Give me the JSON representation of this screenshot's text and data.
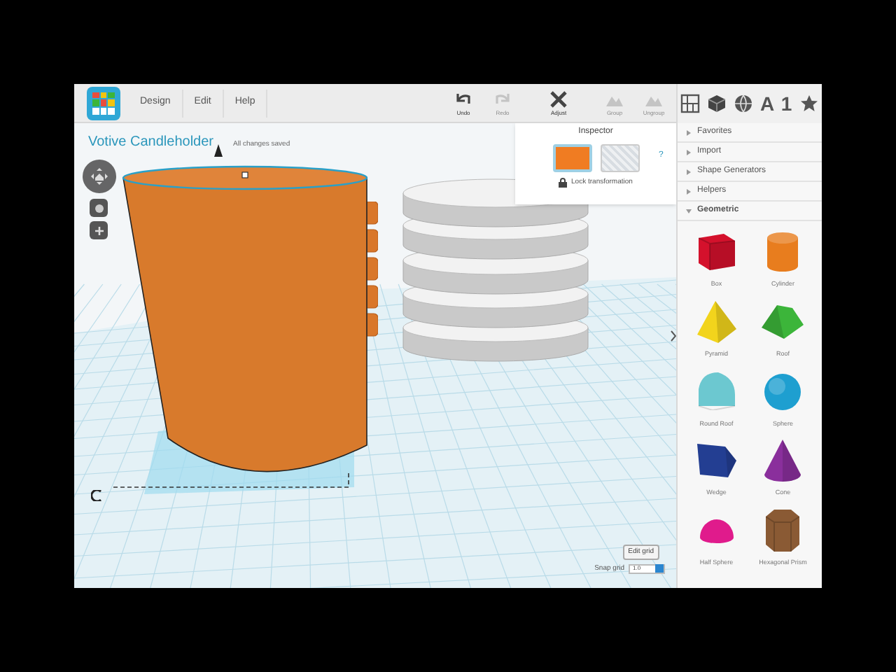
{
  "menu": [
    {
      "label": "Design"
    },
    {
      "label": "Edit"
    },
    {
      "label": "Help"
    }
  ],
  "tools": [
    {
      "kind": "undo",
      "label": "Undo",
      "disabled": false
    },
    {
      "kind": "redo",
      "label": "Redo",
      "disabled": true
    },
    {
      "kind": "adjust",
      "label": "Adjust",
      "disabled": false
    },
    {
      "kind": "group",
      "label": "Group",
      "disabled": true
    },
    {
      "kind": "ungroup",
      "label": "Ungroup",
      "disabled": true
    }
  ],
  "panel_tabs": [
    {
      "kind": "workplane"
    },
    {
      "kind": "cube"
    },
    {
      "kind": "globe"
    },
    {
      "kind": "text",
      "label": "A"
    },
    {
      "kind": "text",
      "label": "1"
    },
    {
      "kind": "star"
    }
  ],
  "design": {
    "title": "Votive Candleholder",
    "save_status": "All changes saved"
  },
  "inspector": {
    "title": "Inspector",
    "help": "?",
    "swatches": [
      {
        "kind": "color",
        "color": "#f07c22",
        "selected": true
      },
      {
        "kind": "hole",
        "selected": false
      }
    ],
    "lock_label": "Lock transformation"
  },
  "sections": [
    {
      "label": "Favorites",
      "expanded": false
    },
    {
      "label": "Import",
      "expanded": false
    },
    {
      "label": "Shape Generators",
      "expanded": false
    },
    {
      "label": "Helpers",
      "expanded": false
    },
    {
      "label": "Geometric",
      "expanded": true
    }
  ],
  "shapes": [
    {
      "kind": "box",
      "label": "Box",
      "color": "#d4112c"
    },
    {
      "kind": "cylinder",
      "label": "Cylinder",
      "color": "#e87d1e"
    },
    {
      "kind": "pyramid",
      "label": "Pyramid",
      "color": "#f2d41c"
    },
    {
      "kind": "roof",
      "label": "Roof",
      "color": "#3cb53a"
    },
    {
      "kind": "roundroof",
      "label": "Round Roof",
      "color": "#6cc8d0"
    },
    {
      "kind": "sphere",
      "label": "Sphere",
      "color": "#1e9fd0"
    },
    {
      "kind": "wedge",
      "label": "Wedge",
      "color": "#233e92"
    },
    {
      "kind": "cone",
      "label": "Cone",
      "color": "#8a2f9c"
    },
    {
      "kind": "halfsphere",
      "label": "Half Sphere",
      "color": "#e01b8c"
    },
    {
      "kind": "hexprism",
      "label": "Hexagonal Prism",
      "color": "#8a5a34"
    }
  ],
  "grid": {
    "edit_label": "Edit grid",
    "snap_label": "Snap grid",
    "snap_value": "1.0"
  }
}
